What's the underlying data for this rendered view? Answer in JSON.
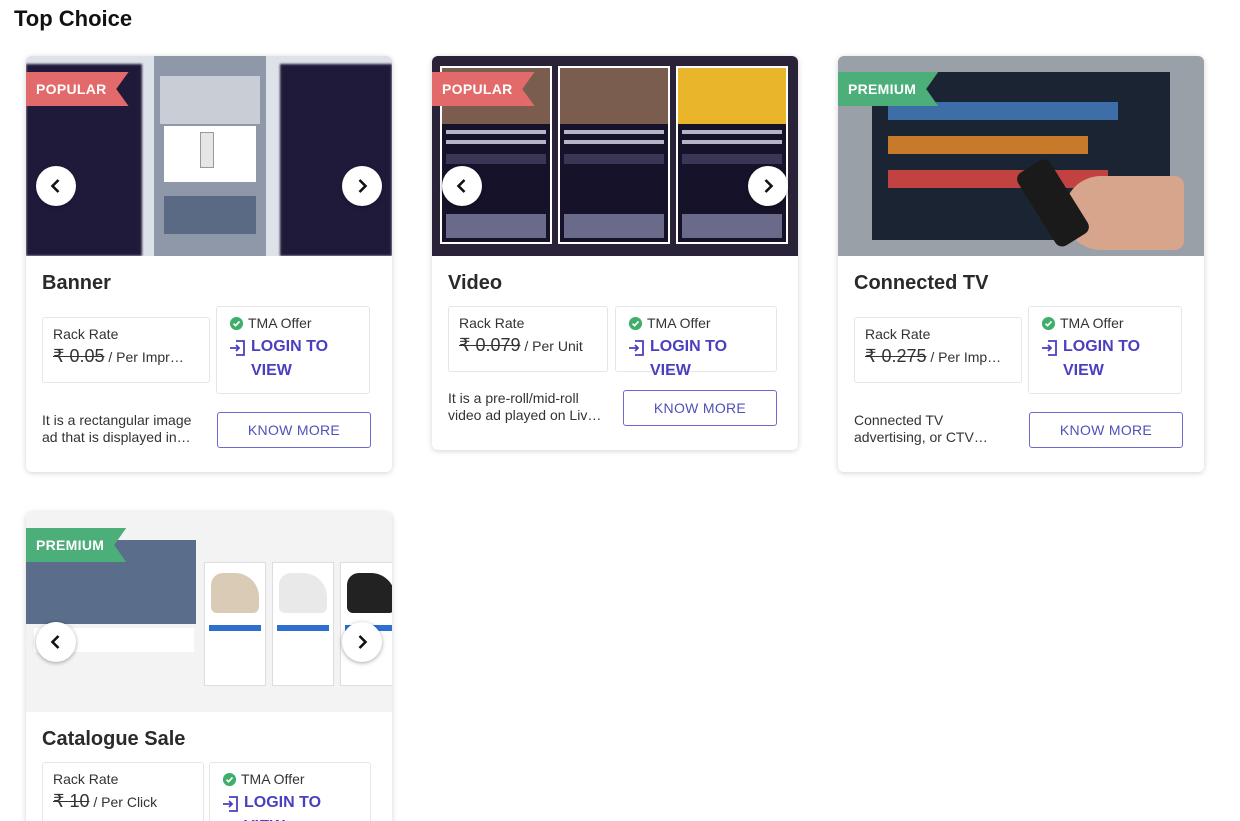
{
  "page": {
    "section_title": "Top Choice"
  },
  "cards": [
    {
      "badge": "POPULAR",
      "title": "Banner",
      "rate_label": "Rack Rate",
      "rate_value": "₹ 0.05",
      "rate_unit": "/ Per Impr…",
      "offer_label": "TMA Offer",
      "login_l1": "LOGIN TO",
      "login_l2": "VIEW",
      "desc_l1": "It is a rectangular image",
      "desc_l2": "ad that is displayed in…",
      "know_more": "KNOW MORE"
    },
    {
      "badge": "POPULAR",
      "title": "Video",
      "rate_label": "Rack Rate",
      "rate_value": "₹ 0.079",
      "rate_unit": "/ Per Unit",
      "offer_label": "TMA Offer",
      "login_l1": "LOGIN TO VIEW",
      "desc_l1": "It is a pre-roll/mid-roll",
      "desc_l2": "video ad played on Liv…",
      "know_more": "KNOW MORE"
    },
    {
      "badge": "PREMIUM",
      "title": "Connected TV",
      "rate_label": "Rack Rate",
      "rate_value": "₹ 0.275",
      "rate_unit": "/ Per Imp…",
      "offer_label": "TMA Offer",
      "login_l1": "LOGIN TO",
      "login_l2": "VIEW",
      "desc_l1": "Connected TV",
      "desc_l2": "advertising, or CTV…",
      "know_more": "KNOW MORE"
    },
    {
      "badge": "PREMIUM",
      "title": "Catalogue Sale",
      "rate_label": "Rack Rate",
      "rate_value": "₹ 10",
      "rate_unit": "/ Per Click",
      "offer_label": "TMA Offer",
      "login_l1": "LOGIN TO VIEW"
    }
  ],
  "colors": {
    "popular": "#e36a6a",
    "premium": "#4caf7a",
    "accent": "#4a3fc0",
    "offer_check": "#3fae6a"
  },
  "icons": {
    "prev": "chevron-left-icon",
    "next": "chevron-right-icon",
    "offer": "verified-badge-icon",
    "login": "login-icon"
  }
}
